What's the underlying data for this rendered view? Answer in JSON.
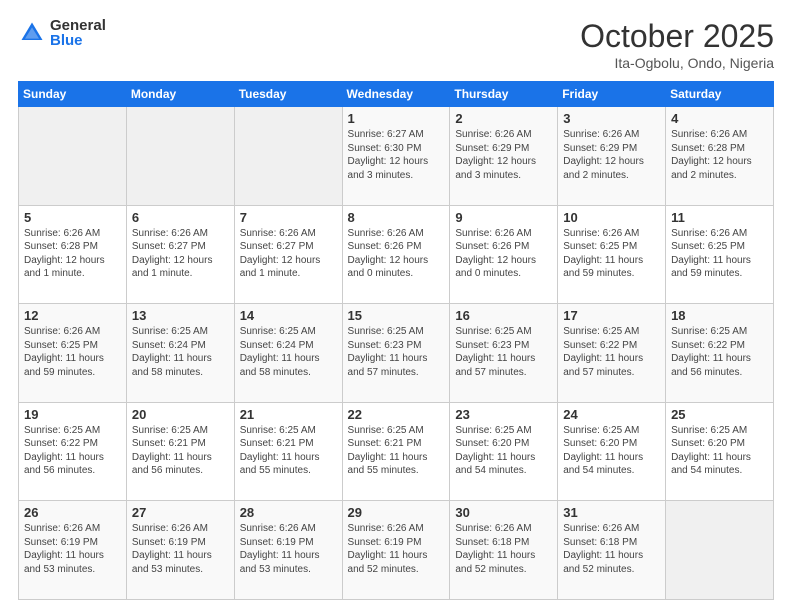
{
  "logo": {
    "general": "General",
    "blue": "Blue"
  },
  "header": {
    "month": "October 2025",
    "location": "Ita-Ogbolu, Ondo, Nigeria"
  },
  "weekdays": [
    "Sunday",
    "Monday",
    "Tuesday",
    "Wednesday",
    "Thursday",
    "Friday",
    "Saturday"
  ],
  "weeks": [
    [
      {
        "day": "",
        "info": ""
      },
      {
        "day": "",
        "info": ""
      },
      {
        "day": "",
        "info": ""
      },
      {
        "day": "1",
        "info": "Sunrise: 6:27 AM\nSunset: 6:30 PM\nDaylight: 12 hours\nand 3 minutes."
      },
      {
        "day": "2",
        "info": "Sunrise: 6:26 AM\nSunset: 6:29 PM\nDaylight: 12 hours\nand 3 minutes."
      },
      {
        "day": "3",
        "info": "Sunrise: 6:26 AM\nSunset: 6:29 PM\nDaylight: 12 hours\nand 2 minutes."
      },
      {
        "day": "4",
        "info": "Sunrise: 6:26 AM\nSunset: 6:28 PM\nDaylight: 12 hours\nand 2 minutes."
      }
    ],
    [
      {
        "day": "5",
        "info": "Sunrise: 6:26 AM\nSunset: 6:28 PM\nDaylight: 12 hours\nand 1 minute."
      },
      {
        "day": "6",
        "info": "Sunrise: 6:26 AM\nSunset: 6:27 PM\nDaylight: 12 hours\nand 1 minute."
      },
      {
        "day": "7",
        "info": "Sunrise: 6:26 AM\nSunset: 6:27 PM\nDaylight: 12 hours\nand 1 minute."
      },
      {
        "day": "8",
        "info": "Sunrise: 6:26 AM\nSunset: 6:26 PM\nDaylight: 12 hours\nand 0 minutes."
      },
      {
        "day": "9",
        "info": "Sunrise: 6:26 AM\nSunset: 6:26 PM\nDaylight: 12 hours\nand 0 minutes."
      },
      {
        "day": "10",
        "info": "Sunrise: 6:26 AM\nSunset: 6:25 PM\nDaylight: 11 hours\nand 59 minutes."
      },
      {
        "day": "11",
        "info": "Sunrise: 6:26 AM\nSunset: 6:25 PM\nDaylight: 11 hours\nand 59 minutes."
      }
    ],
    [
      {
        "day": "12",
        "info": "Sunrise: 6:26 AM\nSunset: 6:25 PM\nDaylight: 11 hours\nand 59 minutes."
      },
      {
        "day": "13",
        "info": "Sunrise: 6:25 AM\nSunset: 6:24 PM\nDaylight: 11 hours\nand 58 minutes."
      },
      {
        "day": "14",
        "info": "Sunrise: 6:25 AM\nSunset: 6:24 PM\nDaylight: 11 hours\nand 58 minutes."
      },
      {
        "day": "15",
        "info": "Sunrise: 6:25 AM\nSunset: 6:23 PM\nDaylight: 11 hours\nand 57 minutes."
      },
      {
        "day": "16",
        "info": "Sunrise: 6:25 AM\nSunset: 6:23 PM\nDaylight: 11 hours\nand 57 minutes."
      },
      {
        "day": "17",
        "info": "Sunrise: 6:25 AM\nSunset: 6:22 PM\nDaylight: 11 hours\nand 57 minutes."
      },
      {
        "day": "18",
        "info": "Sunrise: 6:25 AM\nSunset: 6:22 PM\nDaylight: 11 hours\nand 56 minutes."
      }
    ],
    [
      {
        "day": "19",
        "info": "Sunrise: 6:25 AM\nSunset: 6:22 PM\nDaylight: 11 hours\nand 56 minutes."
      },
      {
        "day": "20",
        "info": "Sunrise: 6:25 AM\nSunset: 6:21 PM\nDaylight: 11 hours\nand 56 minutes."
      },
      {
        "day": "21",
        "info": "Sunrise: 6:25 AM\nSunset: 6:21 PM\nDaylight: 11 hours\nand 55 minutes."
      },
      {
        "day": "22",
        "info": "Sunrise: 6:25 AM\nSunset: 6:21 PM\nDaylight: 11 hours\nand 55 minutes."
      },
      {
        "day": "23",
        "info": "Sunrise: 6:25 AM\nSunset: 6:20 PM\nDaylight: 11 hours\nand 54 minutes."
      },
      {
        "day": "24",
        "info": "Sunrise: 6:25 AM\nSunset: 6:20 PM\nDaylight: 11 hours\nand 54 minutes."
      },
      {
        "day": "25",
        "info": "Sunrise: 6:25 AM\nSunset: 6:20 PM\nDaylight: 11 hours\nand 54 minutes."
      }
    ],
    [
      {
        "day": "26",
        "info": "Sunrise: 6:26 AM\nSunset: 6:19 PM\nDaylight: 11 hours\nand 53 minutes."
      },
      {
        "day": "27",
        "info": "Sunrise: 6:26 AM\nSunset: 6:19 PM\nDaylight: 11 hours\nand 53 minutes."
      },
      {
        "day": "28",
        "info": "Sunrise: 6:26 AM\nSunset: 6:19 PM\nDaylight: 11 hours\nand 53 minutes."
      },
      {
        "day": "29",
        "info": "Sunrise: 6:26 AM\nSunset: 6:19 PM\nDaylight: 11 hours\nand 52 minutes."
      },
      {
        "day": "30",
        "info": "Sunrise: 6:26 AM\nSunset: 6:18 PM\nDaylight: 11 hours\nand 52 minutes."
      },
      {
        "day": "31",
        "info": "Sunrise: 6:26 AM\nSunset: 6:18 PM\nDaylight: 11 hours\nand 52 minutes."
      },
      {
        "day": "",
        "info": ""
      }
    ]
  ]
}
